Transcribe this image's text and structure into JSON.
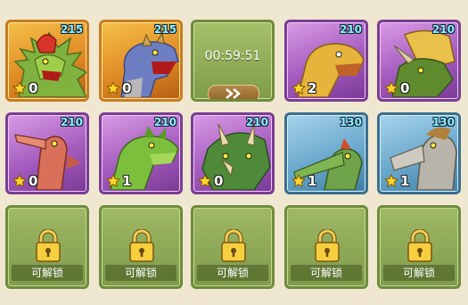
{
  "grid": {
    "row1": [
      {
        "level": "215",
        "stars": "0",
        "color": "#c57d20"
      },
      {
        "level": "215",
        "stars": "0",
        "color": "#c57d20"
      },
      {
        "timer": "00:59:51",
        "skip_icon": "fast-forward-icon"
      },
      {
        "level": "210",
        "stars": "2",
        "color": "#7a3d93"
      },
      {
        "level": "210",
        "stars": "0",
        "color": "#7a3d93"
      }
    ],
    "row2": [
      {
        "level": "210",
        "stars": "0",
        "color": "#7a3d93"
      },
      {
        "level": "210",
        "stars": "1",
        "color": "#7a3d93"
      },
      {
        "level": "210",
        "stars": "0",
        "color": "#7a3d93"
      },
      {
        "level": "130",
        "stars": "1",
        "color": "#3b6f8e"
      },
      {
        "level": "130",
        "stars": "1",
        "color": "#3b6f8e"
      }
    ],
    "row3": [
      {
        "label": "可解锁",
        "icon": "lock-icon"
      },
      {
        "label": "可解锁",
        "icon": "lock-icon"
      },
      {
        "label": "可解锁",
        "icon": "lock-icon"
      },
      {
        "label": "可解锁",
        "icon": "lock-icon"
      },
      {
        "label": "可解锁",
        "icon": "lock-icon"
      }
    ]
  },
  "colors": {
    "background": "#efe7cf",
    "level_text": "#8ef0ff",
    "rarity_orange": "#c57d20",
    "rarity_purple": "#7a3d93",
    "rarity_blue": "#3b6f8e",
    "locked_green": "#7f9b4a"
  }
}
